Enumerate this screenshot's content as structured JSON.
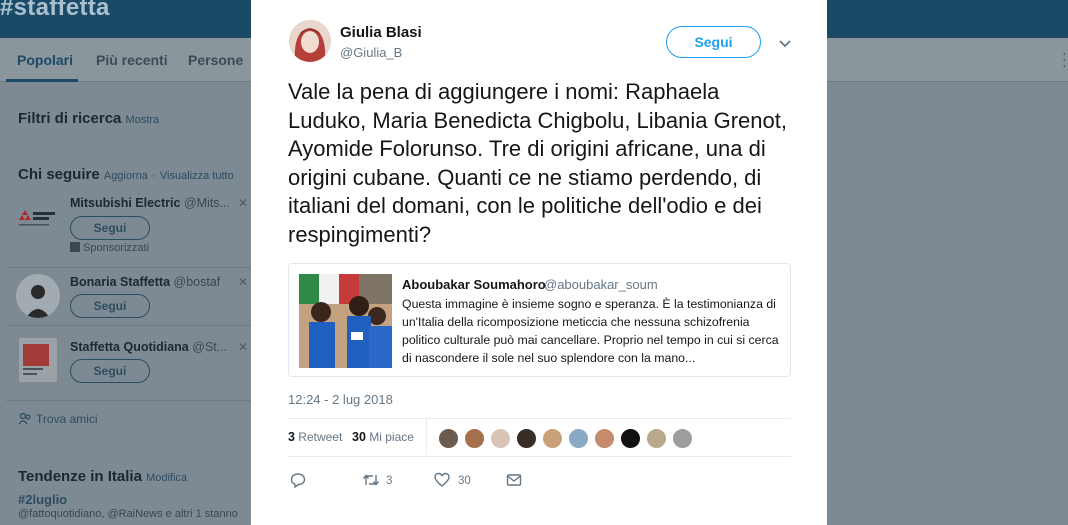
{
  "background": {
    "hashtag": "#staffetta",
    "nav": {
      "popular": "Popolari",
      "recent": "Più recenti",
      "people": "Persone"
    },
    "filters": {
      "title": "Filtri di ricerca",
      "link": "Mostra"
    },
    "who_to_follow": {
      "title": "Chi seguire",
      "refresh": "Aggiorna",
      "view_all": "Visualizza tutto",
      "items": [
        {
          "name": "Mitsubishi Electric",
          "handle": "@Mits...",
          "button": "Segui",
          "sponsored": "Sponsorizzati"
        },
        {
          "name": "Bonaria Staffetta",
          "handle": "@bostaf",
          "button": "Segui"
        },
        {
          "name": "Staffetta Quotidiana",
          "handle": "@St...",
          "button": "Segui"
        }
      ],
      "find_friends": "Trova amici"
    },
    "trends": {
      "title": "Tendenze in Italia",
      "change": "Modifica",
      "items": [
        {
          "tag": "#2luglio",
          "meta": "@fattoquotidiano, @RaiNews e altri 1 stanno"
        }
      ]
    }
  },
  "tweet": {
    "author_name": "Giulia Blasi",
    "author_handle": "@Giulia_B",
    "follow_label": "Segui",
    "text": "Vale la pena di aggiungere i nomi: Raphaela Luduko, Maria Benedicta Chigbolu, Libania Grenot, Ayomide Folorunso. Tre di origini africane, una di origini cubane. Quanti ce ne stiamo perdendo, di italiani del domani, con le politiche dell'odio e dei respingimenti?",
    "quote": {
      "name": "Aboubakar Soumahoro",
      "handle": "@aboubakar_soum",
      "text": "Questa immagine è insieme sogno e speranza. È la testimonianza di un'Italia della ricomposizione meticcia che nessuna schizofrenia politico culturale può mai cancellare. Proprio nel tempo in cui si cerca di nascondere il sole nel suo splendore con la mano..."
    },
    "timestamp": "12:24 - 2 lug 2018",
    "retweets_count": "3",
    "retweets_label": "Retweet",
    "likes_count": "30",
    "likes_label": "Mi piace",
    "actions": {
      "retweet_count": "3",
      "like_count": "30"
    },
    "liker_colors": [
      "#6b5a4e",
      "#a36f4c",
      "#d9c4b8",
      "#3a2d25",
      "#c9a27a",
      "#8aa9c4",
      "#c58b6a",
      "#111111",
      "#b8a98c",
      "#9d9d9d"
    ]
  }
}
